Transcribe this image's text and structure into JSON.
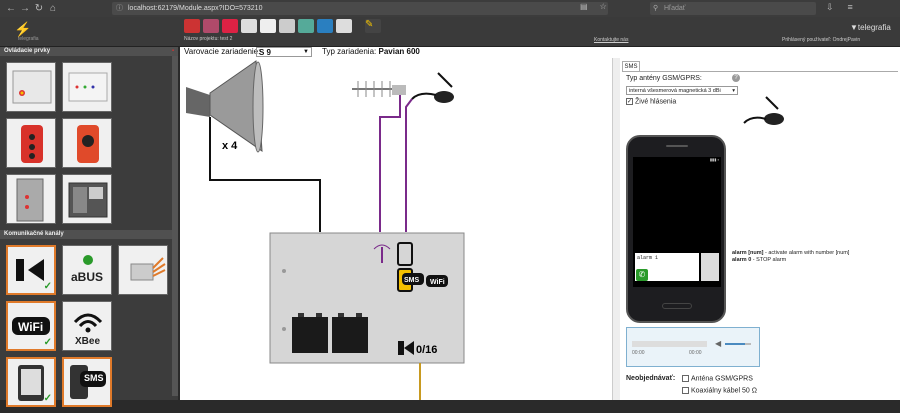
{
  "browser": {
    "url": "localhost:62179/Module.aspx?IDO=573210",
    "search_placeholder": "Hľadať"
  },
  "app": {
    "project_name": "Názov projektu: test 2",
    "contact": "Kontaktujte nás",
    "user": "Prihlásený používateľ: OndrejPavin",
    "brand": "telegrafia"
  },
  "sidebar": {
    "section1_title": "Ovládacie prvky",
    "section2_title": "Komunikačné kanály",
    "channels": [
      "aBUS",
      "XBee",
      "SMS"
    ]
  },
  "canvas": {
    "warning_label": "Varovacie zariadenie:",
    "warning_value": "S 9",
    "type_label": "Typ zariadenia:",
    "type_value": "Pavian 600",
    "multiplier": "x 4",
    "counter": "0/16",
    "sms_badge": "SMS"
  },
  "panel": {
    "tab": "SMS",
    "antenna_label": "Typ antény GSM/GPRS:",
    "antenna_value": "interná všesmerová magnetická 3 dBi",
    "live_label": "Živé hlásenia",
    "live_checked": true,
    "screen_message": "alarm 1",
    "alarm_help_1_cmd": "alarm [num]",
    "alarm_help_1_desc": " - activate alarm with number [num]",
    "alarm_help_2_cmd": "alarm 0",
    "alarm_help_2_desc": " - STOP alarm",
    "audio_time_start": "00:00",
    "audio_time_end": "00:00",
    "unordered_label": "Neobjednávať:",
    "option1": "Anténa GSM/GPRS",
    "option2": "Koaxiálny kábel 50 Ω"
  }
}
